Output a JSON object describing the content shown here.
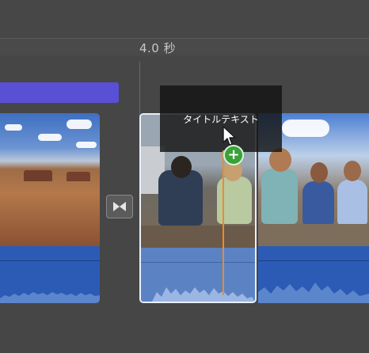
{
  "timeline": {
    "time_marker": "4.0 秒"
  },
  "title_overlay": {
    "text": "タイトルテキスト"
  },
  "add_badge": {
    "symbol": "+"
  },
  "icons": {
    "transition": "transition-bowtie-icon",
    "cursor": "arrow-pointer-icon",
    "add": "plus-circle-icon"
  },
  "colors": {
    "title_bar": "#5a50d6",
    "playhead": "#f08a27",
    "selection_border": "#e9eef8",
    "add_badge": "#3aa13a",
    "audio": "#2c5bb6"
  }
}
